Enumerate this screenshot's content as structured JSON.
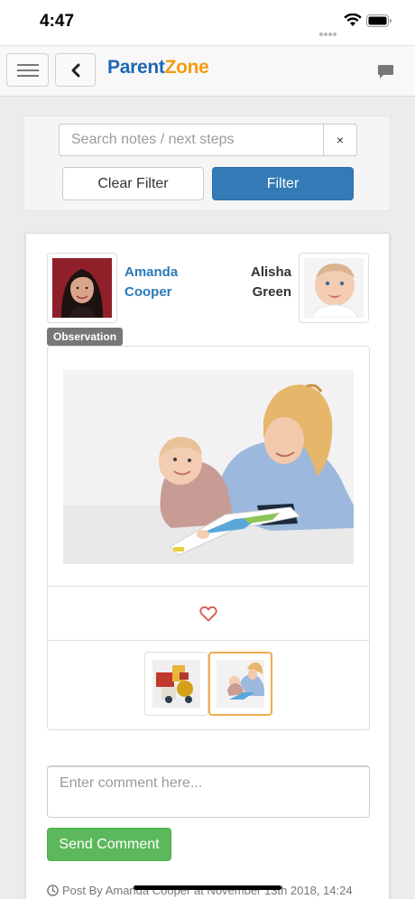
{
  "status_bar": {
    "time": "4:47",
    "icons": [
      "signal-dots-icon",
      "wifi-icon",
      "battery-icon"
    ]
  },
  "navbar": {
    "menu_icon": "hamburger-icon",
    "back_icon": "chevron-left-icon",
    "brand_part1": "Parent",
    "brand_part2": "Zone",
    "chat_icon": "chat-bubble-icon",
    "brand_colors": {
      "parent": "#1e67b4",
      "zone": "#f39c12"
    }
  },
  "filter": {
    "search_placeholder": "Search notes / next steps",
    "search_value": "",
    "clear_x_label": "×",
    "clear_filter_label": "Clear Filter",
    "filter_label": "Filter"
  },
  "note": {
    "author_name": "Amanda Cooper",
    "child_name": "Alisha Green",
    "badge": "Observation",
    "main_photo": "photo-mother-and-baby-reading",
    "like_icon": "heart-outline-icon",
    "thumbnails": [
      {
        "name": "photo-toys",
        "selected": false
      },
      {
        "name": "photo-mother-and-baby-reading",
        "selected": true
      }
    ]
  },
  "comment": {
    "placeholder": "Enter comment here...",
    "value": "",
    "send_label": "Send Comment"
  },
  "post_meta": {
    "clock_icon": "clock-icon",
    "text": "Post By Amanda Cooper at November 13th 2018, 14:24"
  },
  "colors": {
    "primary": "#337ab7",
    "success": "#5cb85c",
    "badge": "#777777",
    "link": "#2a7ab9",
    "selected_border": "#f0ad4e",
    "heart": "#d9534f"
  }
}
